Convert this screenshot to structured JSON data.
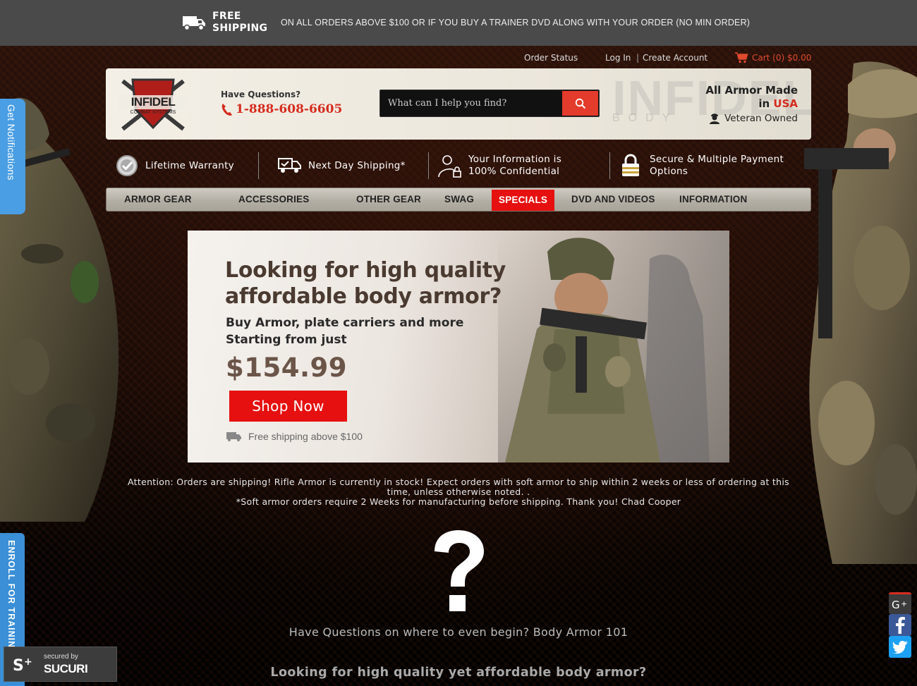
{
  "promo": {
    "free_label": "FREE SHIPPING",
    "message": "ON ALL ORDERS ABOVE $100 OR IF YOU BUY A TRAINER DVD ALONG WITH YOUR ORDER (NO MIN ORDER)"
  },
  "utility_nav": {
    "order_status": "Order Status",
    "login": "Log In",
    "divider": "|",
    "create_account": "Create Account",
    "cart": "Cart (0) $0.00"
  },
  "header": {
    "have_questions": "Have Questions?",
    "phone": "1-888-608-6605",
    "search_placeholder": "What can I help you find?",
    "tagline_line1": "All Armor Made",
    "tagline_in": "in ",
    "tagline_usa": "USA",
    "veteran": "Veteran Owned",
    "watermark_big": "INFIDEL",
    "watermark_small": "BODY"
  },
  "features": [
    {
      "label": "Lifetime Warranty",
      "icon": "check-badge-icon"
    },
    {
      "label": "Next Day Shipping*",
      "icon": "delivery-truck-icon"
    },
    {
      "label_line1": "Your Information is",
      "label_line2": "100% Confidential",
      "icon": "user-lock-icon"
    },
    {
      "label_line1": "Secure & Multiple Payment",
      "label_line2": "Options",
      "icon": "padlock-icon"
    }
  ],
  "nav": [
    {
      "label": "ARMOR GEAR"
    },
    {
      "label": "ACCESSORIES"
    },
    {
      "label": "OTHER GEAR"
    },
    {
      "label": "SWAG"
    },
    {
      "label": "SPECIALS",
      "active": true
    },
    {
      "label": "DVD AND VIDEOS"
    },
    {
      "label": "INFORMATION"
    }
  ],
  "banner": {
    "headline_line1": "Looking for high quality",
    "headline_line2": "affordable body armor?",
    "sub_line1": "Buy Armor, plate carriers and more",
    "sub_line2": "Starting from just",
    "price": "$154.99",
    "cta": "Shop Now",
    "shipping_note": "Free shipping above $100"
  },
  "notice": {
    "line1": "Attention: Orders are shipping!  Rifle Armor is currently in stock! Expect orders with soft armor to ship within 2 weeks or less of ordering at this time, unless otherwise noted. .",
    "line2": "*Soft armor orders require 2 Weeks for manufacturing before shipping. Thank you!  Chad Cooper"
  },
  "questions_text": "Have Questions on where to even begin? Body Armor 101",
  "looking_heading": "Looking for high quality yet affordable body armor?",
  "side_tabs": {
    "notifications": "Get Notifications",
    "enroll": "ENROLL FOR TRAINING"
  },
  "sucuri": {
    "line1": "secured by",
    "line2": "SUCURI"
  },
  "colors": {
    "accent_red": "#e5100f",
    "phone_red": "#d52b1e",
    "tab_blue": "#4a9ee3",
    "promo_bar": "#4a4a4a"
  }
}
